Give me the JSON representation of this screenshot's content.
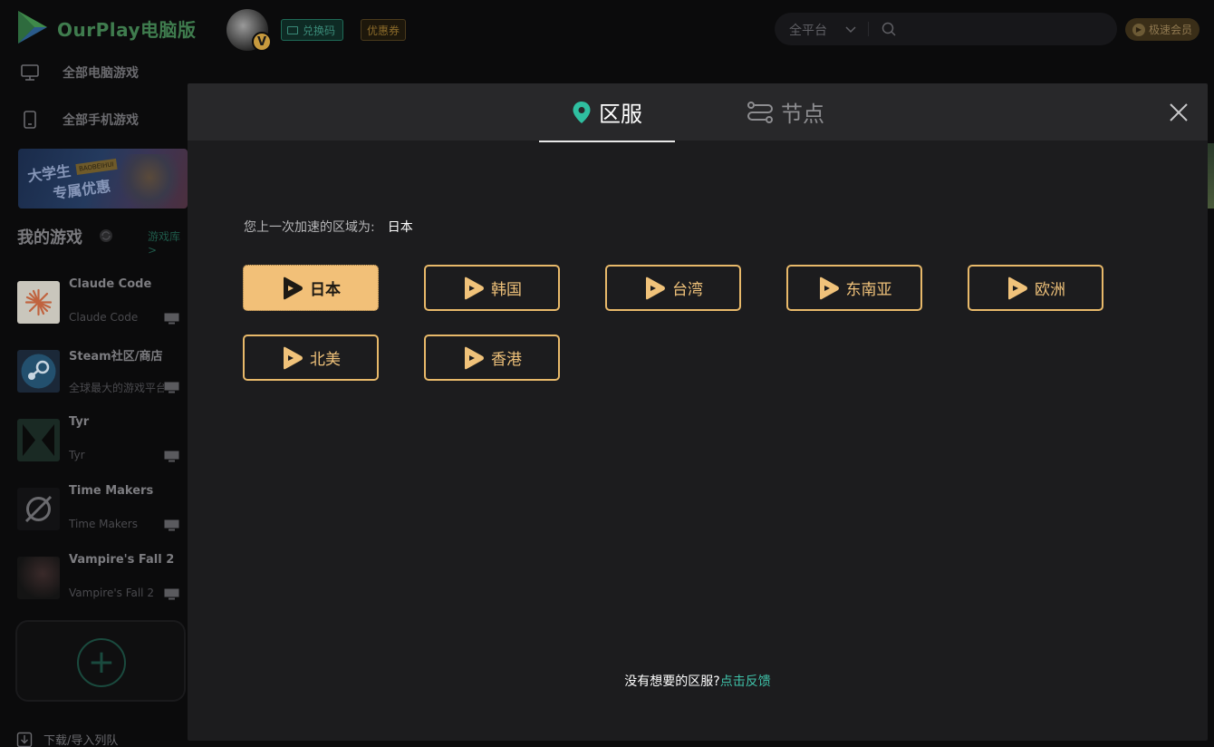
{
  "app": {
    "name": "OurPlay电脑版",
    "redeem_label": "兑换码",
    "coupon_label": "优惠券",
    "platform_label": "全平台",
    "vip_label": "极速会员",
    "avatar_badge": "V"
  },
  "sidebar": {
    "nav": [
      {
        "label": "全部电脑游戏",
        "icon": "monitor-icon"
      },
      {
        "label": "全部手机游戏",
        "icon": "phone-icon"
      }
    ],
    "banner": {
      "line1": "大学生",
      "line2": "专属优惠",
      "tag": "BAOBEIHUI"
    },
    "my_games_title": "我的游戏",
    "library_link": "游戏库 >",
    "games": [
      {
        "name": "Claude Code",
        "sub": "Claude Code"
      },
      {
        "name": "Steam社区/商店",
        "sub": "全球最大的游戏平台"
      },
      {
        "name": "Tyr",
        "sub": "Tyr"
      },
      {
        "name": "Time Makers",
        "sub": "Time Makers"
      },
      {
        "name": "Vampire's Fall 2",
        "sub": "Vampire's Fall 2"
      }
    ],
    "download_queue": "下载/导入列队"
  },
  "modal": {
    "tabs": [
      {
        "label": "区服",
        "icon": "location-pin-icon",
        "active": true
      },
      {
        "label": "节点",
        "icon": "route-icon",
        "active": false
      }
    ],
    "last_region_prefix": "您上一次加速的区域为:",
    "last_region_value": "日本",
    "regions": [
      {
        "label": "日本",
        "selected": true
      },
      {
        "label": "韩国",
        "selected": false
      },
      {
        "label": "台湾",
        "selected": false
      },
      {
        "label": "东南亚",
        "selected": false
      },
      {
        "label": "欧洲",
        "selected": false
      },
      {
        "label": "北美",
        "selected": false
      },
      {
        "label": "香港",
        "selected": false
      }
    ],
    "feedback_question": "没有想要的区服?",
    "feedback_link": "点击反馈"
  },
  "colors": {
    "accent_gold": "#f2c078",
    "accent_teal": "#3fc1a8",
    "modal_bg": "#1c1c1e",
    "brand_green": "#3f7c4e"
  }
}
